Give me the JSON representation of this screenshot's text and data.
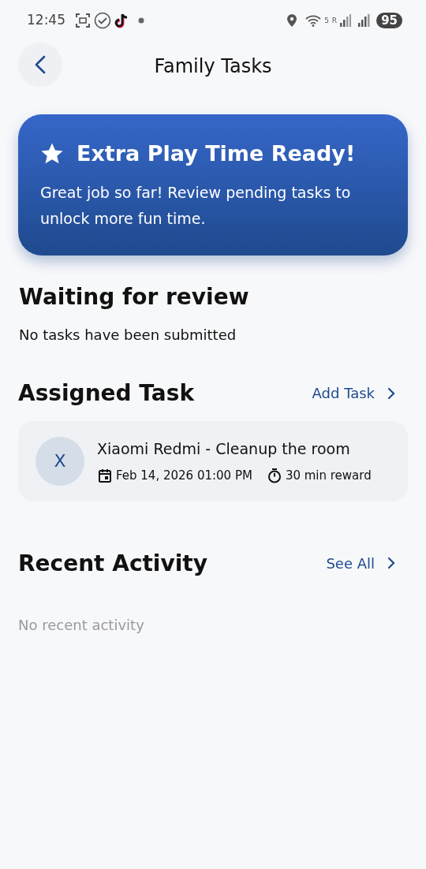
{
  "status_bar": {
    "time": "12:45",
    "wifi_label": "5",
    "sim_label": "R",
    "battery": "95"
  },
  "header": {
    "title": "Family Tasks"
  },
  "banner": {
    "title": "Extra Play Time Ready!",
    "message": "Great job so far! Review pending tasks to unlock more fun time."
  },
  "waiting_review": {
    "title": "Waiting for review",
    "empty_text": "No tasks have been submitted"
  },
  "assigned": {
    "title": "Assigned Task",
    "action": "Add Task",
    "tasks": [
      {
        "initial": "X",
        "title": "Xiaomi Redmi - Cleanup the room",
        "due": "Feb 14, 2026 01:00 PM",
        "reward": "30 min reward"
      }
    ]
  },
  "recent_activity": {
    "title": "Recent Activity",
    "action": "See All",
    "empty_text": "No recent activity"
  }
}
